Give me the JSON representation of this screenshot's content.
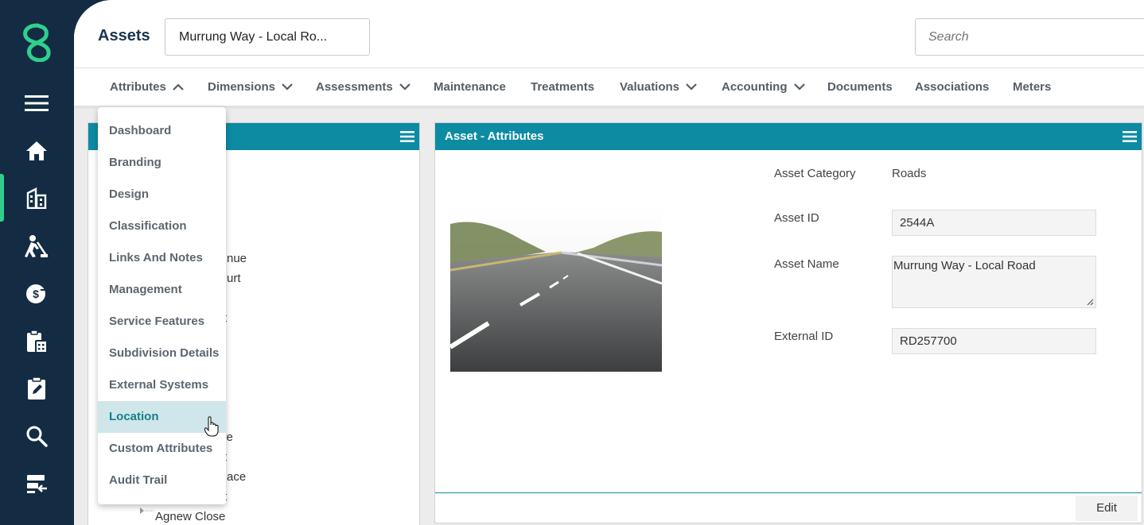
{
  "app": {
    "title": "Assets",
    "asset_selector": "Murrung Way - Local Ro...",
    "search_placeholder": "Search",
    "accent_color": "#0d8ba3",
    "brand_color": "#2fd08e"
  },
  "sidebar": {
    "icons": [
      "menu-icon",
      "home-icon",
      "buildings-icon",
      "worker-icon",
      "finance-icon",
      "clipboard-calc-icon",
      "edit-task-icon",
      "search-icon",
      "import-icon"
    ]
  },
  "nav": {
    "tabs": [
      {
        "label": "Attributes",
        "chevron": "up"
      },
      {
        "label": "Dimensions",
        "chevron": "down"
      },
      {
        "label": "Assessments",
        "chevron": "down"
      },
      {
        "label": "Maintenance"
      },
      {
        "label": "Treatments"
      },
      {
        "label": "Valuations",
        "chevron": "down"
      },
      {
        "label": "Accounting",
        "chevron": "down"
      },
      {
        "label": "Documents"
      },
      {
        "label": "Associations"
      },
      {
        "label": "Meters"
      }
    ]
  },
  "dropdown": {
    "items": [
      {
        "label": "Dashboard"
      },
      {
        "label": "Branding"
      },
      {
        "label": "Design"
      },
      {
        "label": "Classification"
      },
      {
        "label": "Links And Notes"
      },
      {
        "label": "Management"
      },
      {
        "label": "Service Features"
      },
      {
        "label": "Subdivision Details"
      },
      {
        "label": "External Systems"
      },
      {
        "label": "Location",
        "highlighted": true
      },
      {
        "label": "Custom Attributes"
      },
      {
        "label": "Audit Trail"
      }
    ]
  },
  "tree_panel": {
    "visible_fragments": [
      "nue",
      "urt",
      "t",
      "ve",
      "t",
      "ace",
      "t"
    ],
    "last_item": "Agnew Close"
  },
  "attributes_panel": {
    "title": "Asset - Attributes",
    "asset_category_label": "Asset Category",
    "asset_category_value": "Roads",
    "asset_id_label": "Asset ID",
    "asset_id_value": "2544A",
    "asset_name_label": "Asset Name",
    "asset_name_value": "Murrung Way - Local Road",
    "external_id_label": "External ID",
    "external_id_value": "RD257700",
    "edit_label": "Edit"
  }
}
